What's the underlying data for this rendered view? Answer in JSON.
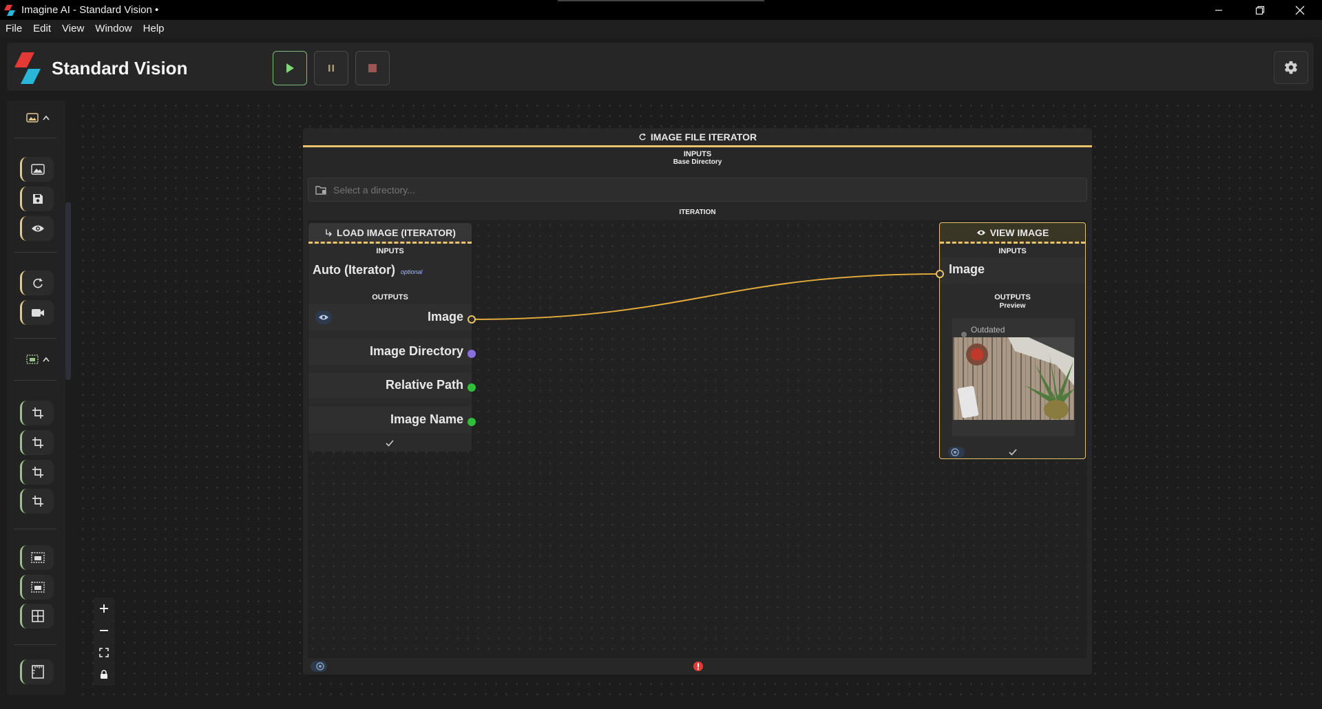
{
  "window": {
    "title": "Imagine AI - Standard Vision •",
    "controls": [
      "minimize-icon",
      "restore-icon",
      "close-icon"
    ]
  },
  "menu": [
    "File",
    "Edit",
    "View",
    "Window",
    "Help"
  ],
  "header": {
    "brand": "Standard Vision",
    "buttons": {
      "run": "play-icon",
      "pause": "pause-icon",
      "stop": "stop-icon"
    },
    "settings": "gear-icon"
  },
  "sidebar": {
    "group1_icons": [
      "image-icon",
      "save-icon",
      "eye-icon",
      "loop-icon",
      "camera-icon"
    ],
    "group2_icons": [
      "crop-icon",
      "crop-icon",
      "crop-icon",
      "crop-icon",
      "frame-icon",
      "frame-icon",
      "grid-icon",
      "ruler-icon"
    ]
  },
  "iterator": {
    "title": "IMAGE FILE ITERATOR",
    "inputs_label": "INPUTS",
    "input_name": "Base Directory",
    "placeholder": "Select a directory...",
    "iteration_label": "ITERATION"
  },
  "load_node": {
    "title": "LOAD IMAGE (ITERATOR)",
    "inputs_label": "INPUTS",
    "input": "Auto (Iterator)",
    "optional": "optional",
    "outputs_label": "OUTPUTS",
    "outputs": [
      "Image",
      "Image Directory",
      "Relative Path",
      "Image Name"
    ]
  },
  "view_node": {
    "title": "VIEW IMAGE",
    "inputs_label": "INPUTS",
    "input": "Image",
    "outputs_label": "OUTPUTS",
    "outputs_sub": "Preview",
    "preview_status": "Outdated"
  },
  "colors": {
    "accent": "#e9c46a",
    "port_purple": "#8a6ee0",
    "port_green": "#2fbf3a",
    "error": "#e03b3b"
  }
}
